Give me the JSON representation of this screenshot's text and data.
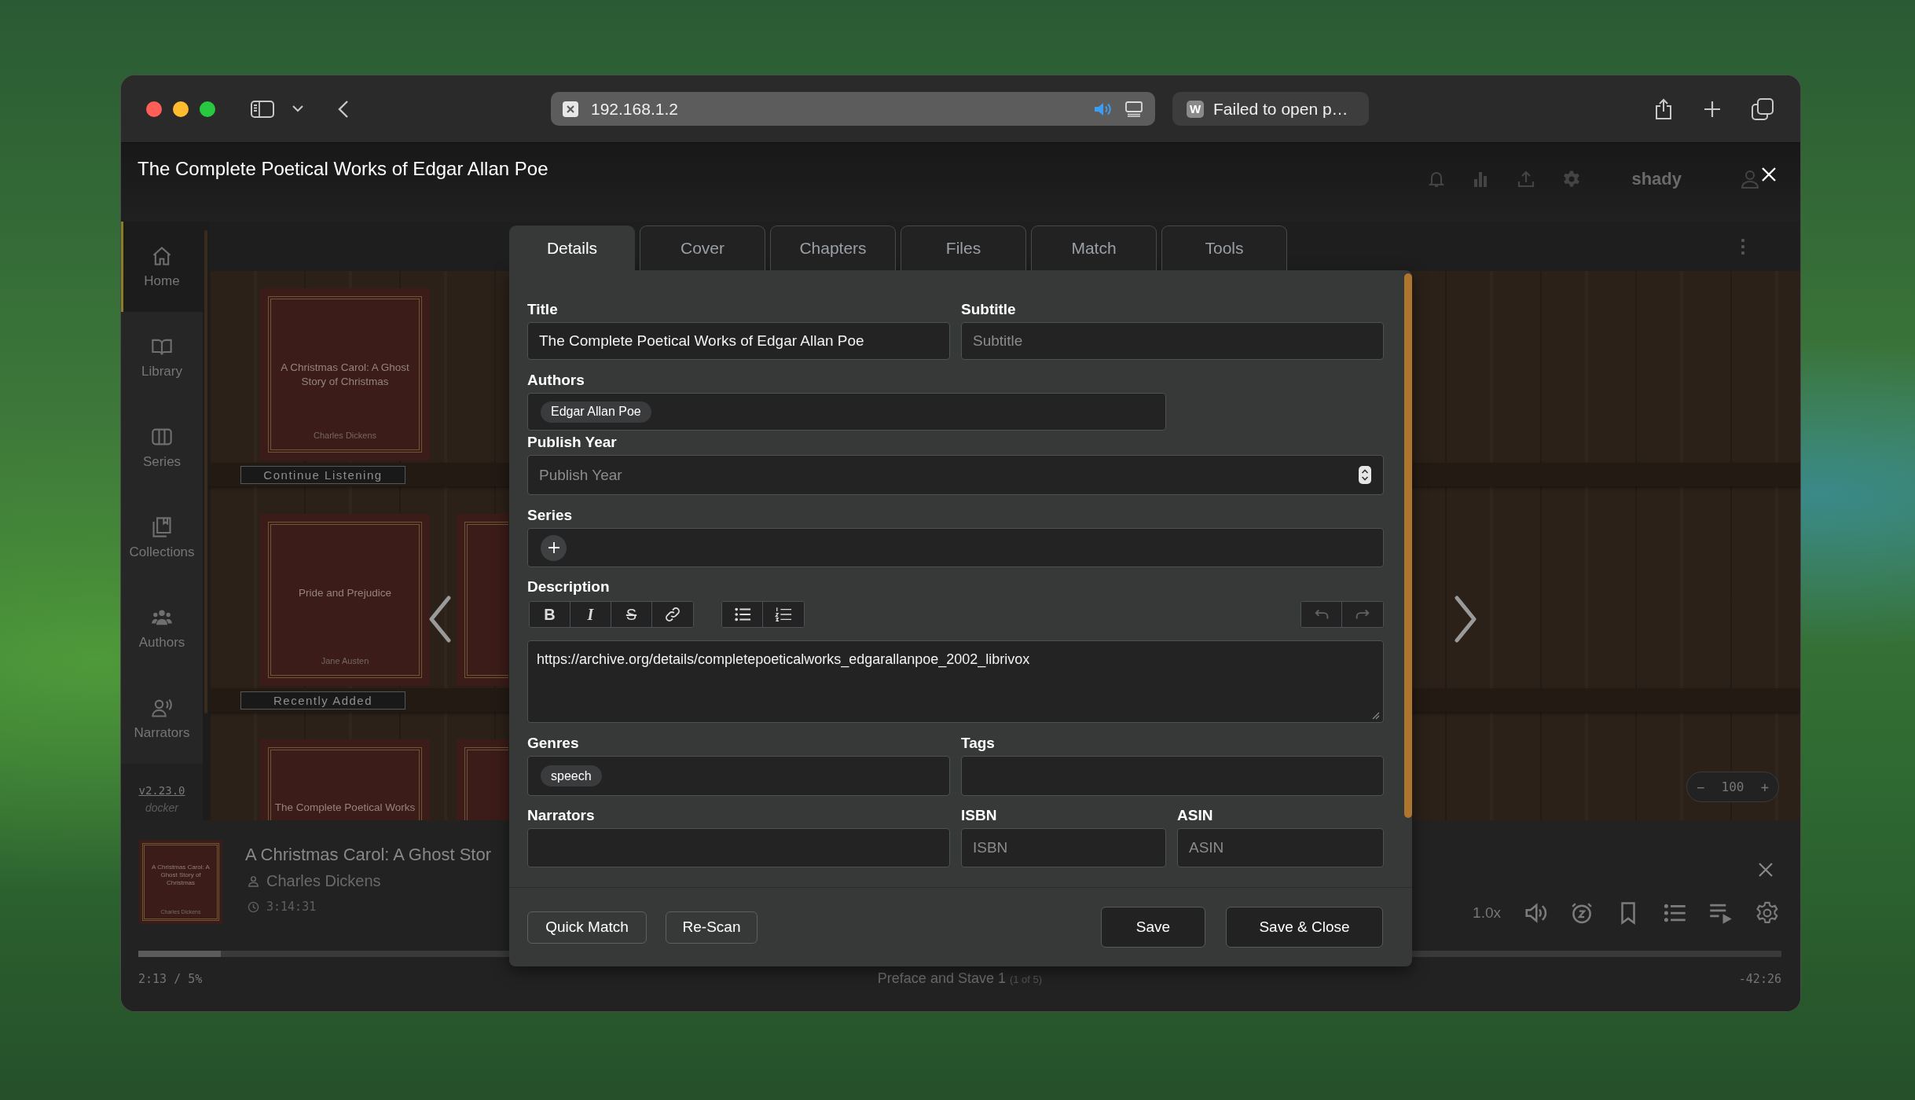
{
  "browser": {
    "window_controls": [
      {
        "color": "#ff5f57"
      },
      {
        "color": "#febc2e"
      },
      {
        "color": "#28c840"
      }
    ],
    "url": "192.168.1.2",
    "audio_playing": true,
    "tab": {
      "favicon": "W",
      "title": "Failed to open p…"
    }
  },
  "header": {
    "username": "shady"
  },
  "sidebar": {
    "items": [
      {
        "label": "Home",
        "selected": true
      },
      {
        "label": "Library",
        "selected": false
      },
      {
        "label": "Series",
        "selected": false
      },
      {
        "label": "Collections",
        "selected": false
      },
      {
        "label": "Authors",
        "selected": false
      },
      {
        "label": "Narrators",
        "selected": false
      }
    ],
    "version": "v2.23.0",
    "build": "docker"
  },
  "shelves": [
    {
      "label": "Continue Listening",
      "books": [
        {
          "kind": "cover",
          "title": "A Christmas Carol: A Ghost Story of Christmas",
          "author": "Charles Dickens"
        }
      ]
    },
    {
      "label": "Recently Added",
      "books": [
        {
          "kind": "cover",
          "title": "Pride and Prejudice",
          "author": "Jane Austen"
        },
        {
          "kind": "edge"
        }
      ]
    },
    {
      "books": [
        {
          "kind": "cover",
          "title": "The Complete Poetical Works"
        },
        {
          "kind": "edge"
        }
      ]
    }
  ],
  "size_control": {
    "minus": "−",
    "value": "100",
    "plus": "+"
  },
  "modal": {
    "title": "The Complete Poetical Works of Edgar Allan Poe",
    "tabs": [
      {
        "label": "Details",
        "selected": true
      },
      {
        "label": "Cover",
        "selected": false
      },
      {
        "label": "Chapters",
        "selected": false
      },
      {
        "label": "Files",
        "selected": false
      },
      {
        "label": "Match",
        "selected": false
      },
      {
        "label": "Tools",
        "selected": false
      }
    ],
    "form": {
      "title": {
        "label": "Title",
        "value": "The Complete Poetical Works of Edgar Allan Poe"
      },
      "subtitle": {
        "label": "Subtitle",
        "placeholder": "Subtitle"
      },
      "authors": {
        "label": "Authors",
        "chips": [
          "Edgar Allan Poe"
        ]
      },
      "publish_year": {
        "label": "Publish Year",
        "placeholder": "Publish Year"
      },
      "series": {
        "label": "Series"
      },
      "description": {
        "label": "Description",
        "format_buttons": [
          "B",
          "I",
          "S"
        ],
        "undo": {
          "disabled": true
        },
        "redo": {
          "disabled": true
        },
        "value": "https://archive.org/details/completepoeticalworks_edgarallanpoe_2002_librivox"
      },
      "genres": {
        "label": "Genres",
        "chips": [
          "speech"
        ]
      },
      "tags": {
        "label": "Tags"
      },
      "narrators": {
        "label": "Narrators"
      },
      "isbn": {
        "label": "ISBN",
        "placeholder": "ISBN"
      },
      "asin": {
        "label": "ASIN",
        "placeholder": "ASIN"
      }
    },
    "footer": {
      "left_buttons": [
        "Quick Match",
        "Re-Scan"
      ],
      "right_buttons": [
        "Save",
        "Save & Close"
      ]
    }
  },
  "player": {
    "cover": {
      "title": "A Christmas Carol: A Ghost Story of Christmas",
      "author": "Charles Dickens"
    },
    "title": "A Christmas Carol: A Ghost Stor",
    "author": "Charles Dickens",
    "duration": "3:14:31",
    "speed": "1.0x",
    "progress": {
      "level": 0.05
    },
    "elapsed": "2:13 / 5%",
    "chapter": "Preface and Stave 1",
    "chapter_position": "(1 of 5)",
    "remaining": "-42:26"
  }
}
